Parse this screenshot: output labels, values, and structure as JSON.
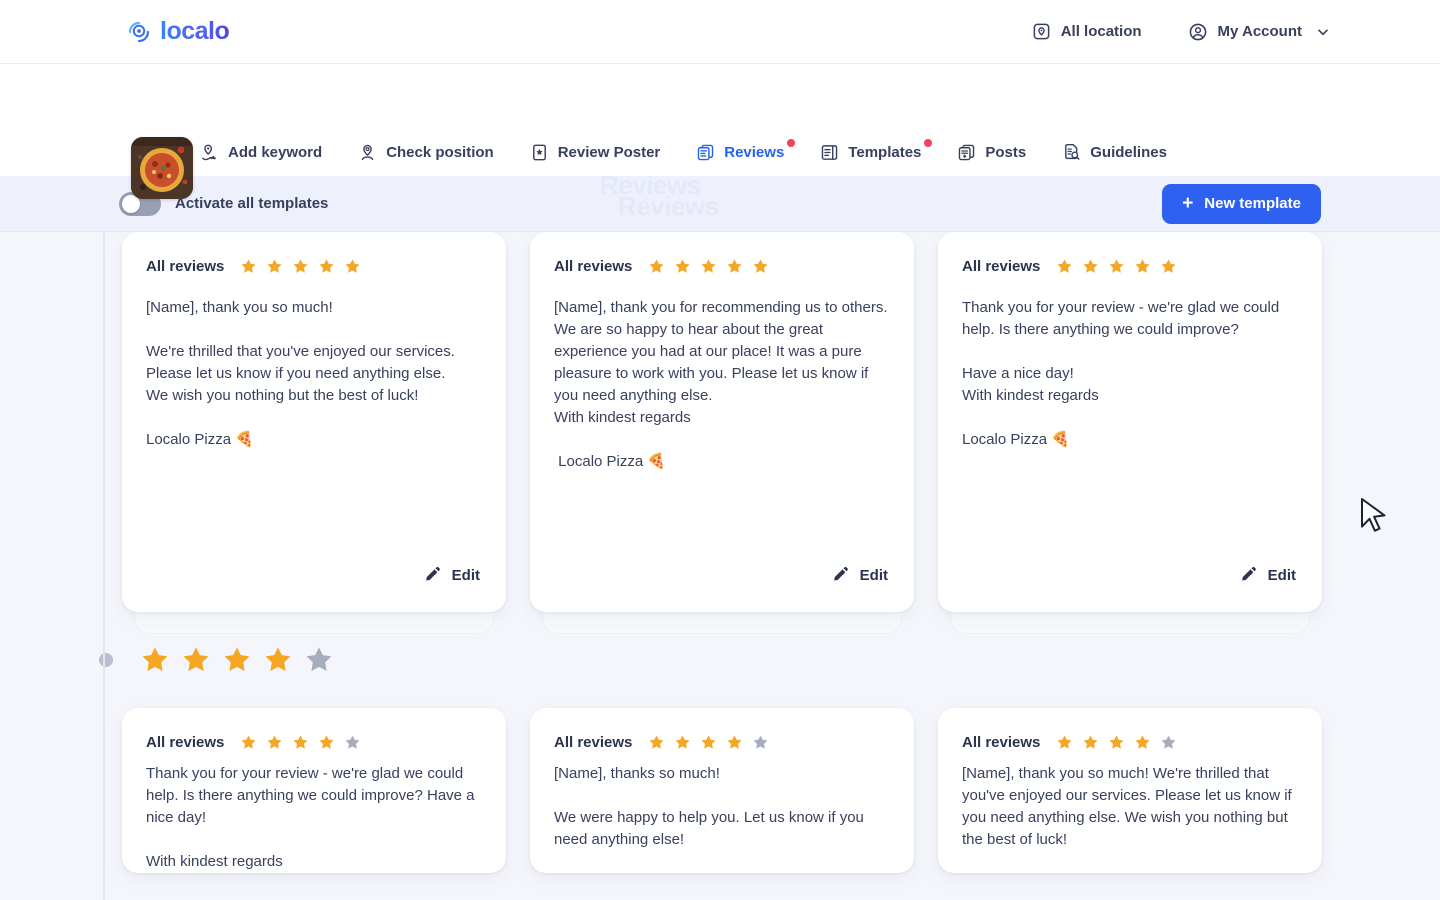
{
  "brand": {
    "name": "localo",
    "logo_icon": "localo-pin-logo"
  },
  "topnav": {
    "items": [
      {
        "label": "All location",
        "icon": "location-square-icon"
      },
      {
        "label": "My Account",
        "icon": "user-circle-icon"
      }
    ]
  },
  "tabs": {
    "business_thumb_alt": "pizza-photo",
    "items": [
      {
        "label": "Add keyword",
        "icon": "pin-arrow-icon",
        "active": false,
        "badge": false
      },
      {
        "label": "Check position",
        "icon": "pin-search-icon",
        "active": false,
        "badge": false
      },
      {
        "label": "Review Poster",
        "icon": "poster-star-icon",
        "active": false,
        "badge": false
      },
      {
        "label": "Reviews",
        "icon": "reviews-stack-icon",
        "active": true,
        "badge": true
      },
      {
        "label": "Templates",
        "icon": "templates-book-icon",
        "active": false,
        "badge": true
      },
      {
        "label": "Posts",
        "icon": "posts-stack-icon",
        "active": false,
        "badge": false
      },
      {
        "label": "Guidelines",
        "icon": "document-search-icon",
        "active": false,
        "badge": false
      }
    ]
  },
  "toolbar": {
    "toggle_label": "Activate all templates",
    "toggle_on": false,
    "new_template_label": "New template",
    "plus_icon": "+",
    "watermark_line1": "Reviews",
    "watermark_line2": "Reviews"
  },
  "colors": {
    "accent_blue": "#2f61f0",
    "active_tab_text": "#2563eb",
    "star_on": "#f5a623",
    "star_off": "#a8adbd",
    "badge_red": "#f43f5e",
    "page_bg": "#f4f6fb",
    "toolbar_bg": "#eef1fb"
  },
  "sections": [
    {
      "rating": 5,
      "cards": [
        {
          "head_label": "All reviews",
          "rating": 5,
          "text": "[Name], thank you so much!\n\nWe're thrilled that you've enjoyed our services.\nPlease let us know if you need anything else.\nWe wish you nothing but the best of luck!\n\nLocalo Pizza 🍕",
          "edit_label": "Edit",
          "edit_icon": "pencil-icon"
        },
        {
          "head_label": "All reviews",
          "rating": 5,
          "text": "[Name], thank you for recommending us to others. We are so happy to hear about the great experience you had at our place! It was a pure pleasure to work with you. Please let us know if you need anything else.\nWith kindest regards\n\n Localo Pizza 🍕",
          "edit_label": "Edit",
          "edit_icon": "pencil-icon"
        },
        {
          "head_label": "All reviews",
          "rating": 5,
          "text": "Thank you for your review - we're glad we could help. Is there anything we could improve?\n\nHave a nice day!\nWith kindest regards\n\nLocalo Pizza 🍕",
          "edit_label": "Edit",
          "edit_icon": "pencil-icon"
        }
      ]
    },
    {
      "rating": 4,
      "cards": [
        {
          "head_label": "All reviews",
          "rating": 4,
          "text": "Thank you for your review - we're glad we could help. Is there anything we could improve? Have a nice day!\n\nWith kindest regards",
          "edit_label": "Edit",
          "edit_icon": "pencil-icon"
        },
        {
          "head_label": "All reviews",
          "rating": 4,
          "text": "[Name], thanks so much!\n\nWe were happy to help you. Let us know if you need anything else!",
          "edit_label": "Edit",
          "edit_icon": "pencil-icon"
        },
        {
          "head_label": "All reviews",
          "rating": 4,
          "text": "[Name], thank you so much! We're thrilled that you've enjoyed our services. Please let us know if you need anything else. We wish you nothing but the best of luck!",
          "edit_label": "Edit",
          "edit_icon": "pencil-icon"
        }
      ]
    }
  ],
  "cursor": {
    "icon": "mouse-pointer-icon"
  }
}
